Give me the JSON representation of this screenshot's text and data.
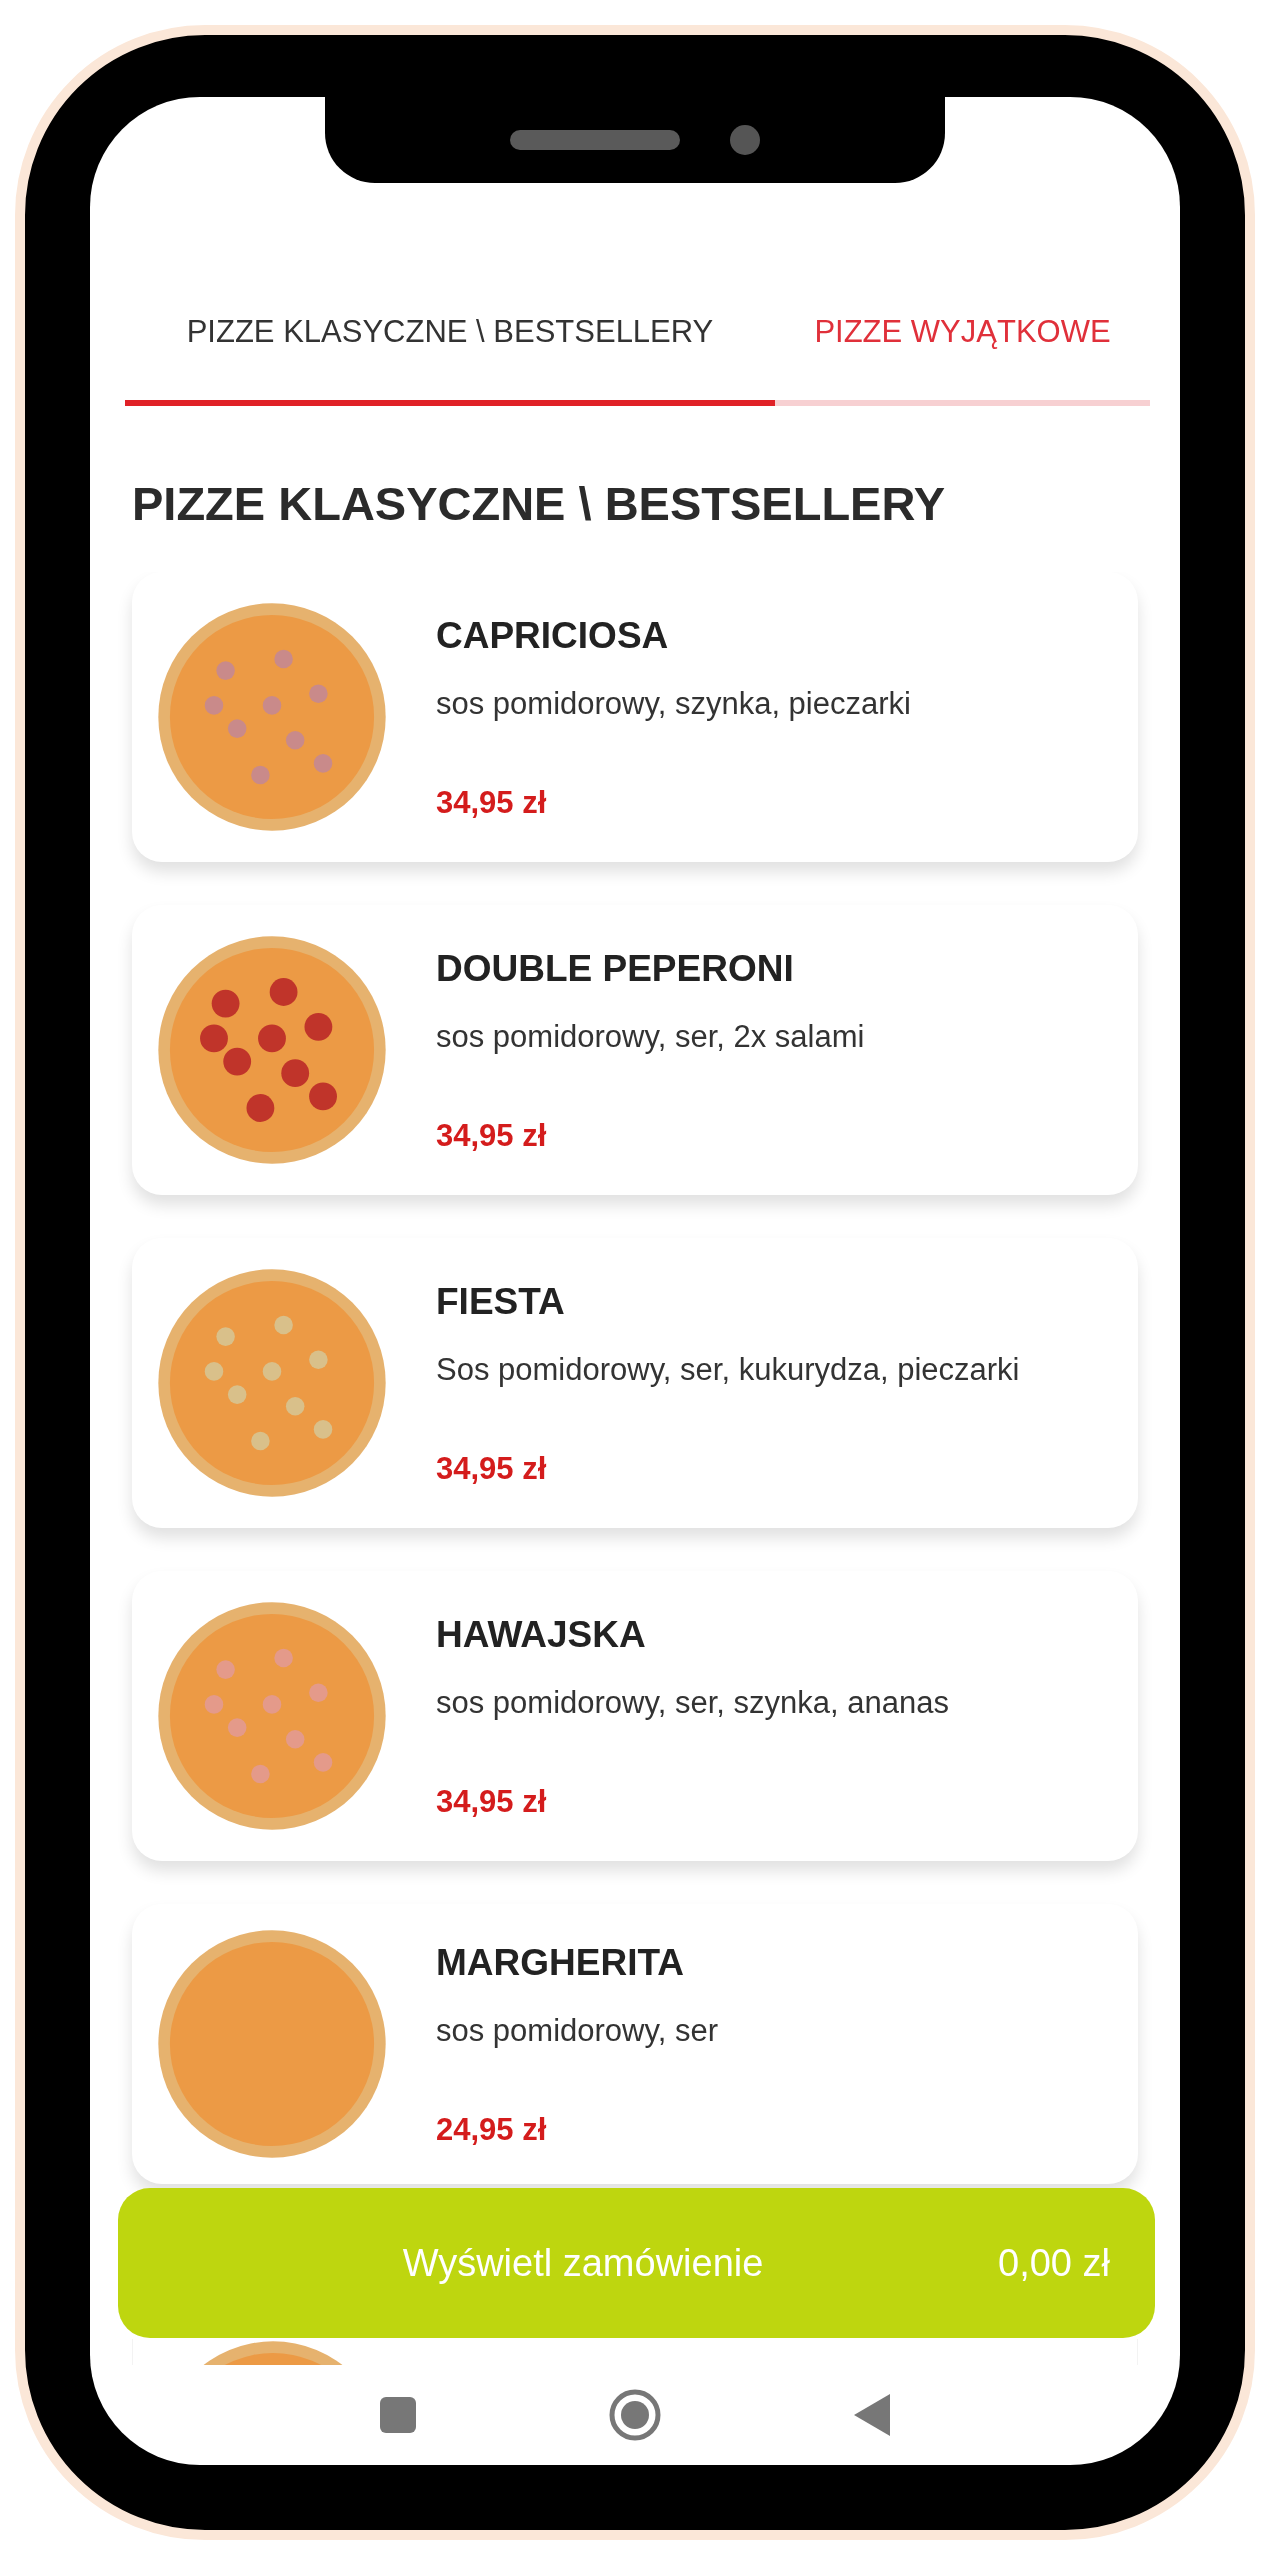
{
  "tabs": [
    {
      "label": "PIZZE KLASYCZNE \\ BESTSELLERY",
      "selected": true
    },
    {
      "label": "PIZZE WYJĄTKOWE",
      "selected": false
    }
  ],
  "section_title": "PIZZE KLASYCZNE \\ BESTSELLERY",
  "products": [
    {
      "name": "CAPRICIOSA",
      "description": "sos pomidorowy, szynka, pieczarki",
      "price": "34,95 zł"
    },
    {
      "name": "DOUBLE PEPERONI",
      "description": "sos pomidorowy, ser, 2x salami",
      "price": "34,95 zł"
    },
    {
      "name": "FIESTA",
      "description": "Sos pomidorowy, ser, kukurydza, pieczarki",
      "price": "34,95 zł"
    },
    {
      "name": "HAWAJSKA",
      "description": "sos pomidorowy, ser, szynka, ananas",
      "price": "34,95 zł"
    },
    {
      "name": "MARGHERITA",
      "description": "sos pomidorowy, ser",
      "price": "24,95 zł"
    }
  ],
  "order_button": {
    "label": "Wyświetl zamówienie",
    "total": "0,00 zł"
  }
}
